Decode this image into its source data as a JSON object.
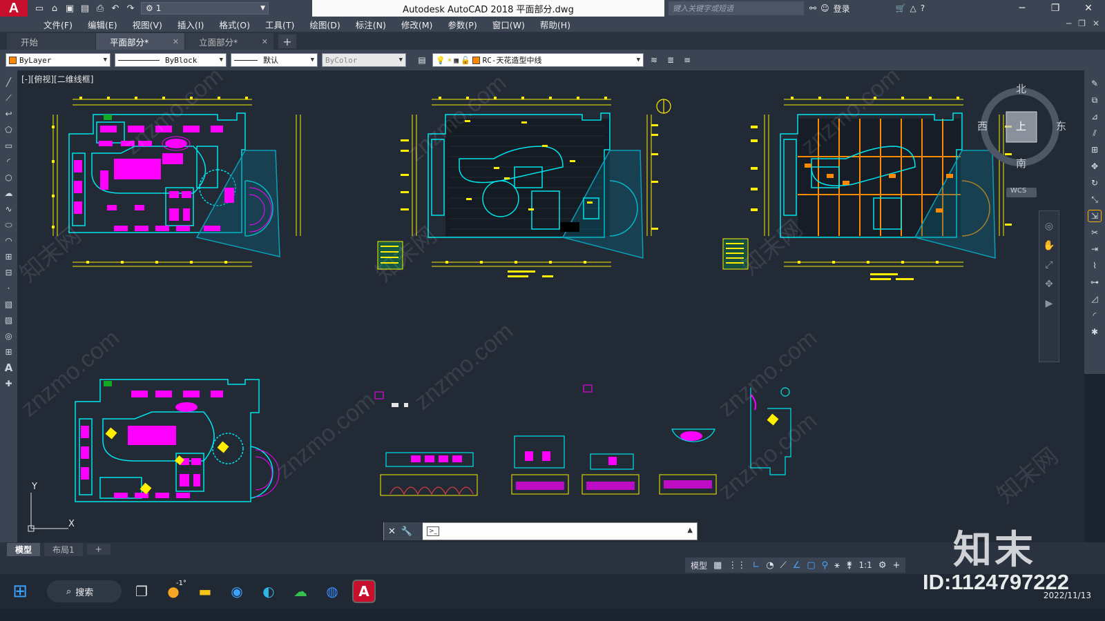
{
  "titlebar": {
    "logo": "A",
    "workspace": "1",
    "title": "Autodesk AutoCAD 2018    平面部分.dwg",
    "search_placeholder": "键入关键字或短语",
    "signin": "登录"
  },
  "menu": {
    "items": [
      "文件(F)",
      "编辑(E)",
      "视图(V)",
      "插入(I)",
      "格式(O)",
      "工具(T)",
      "绘图(D)",
      "标注(N)",
      "修改(M)",
      "参数(P)",
      "窗口(W)",
      "帮助(H)"
    ]
  },
  "tabs": {
    "items": [
      {
        "label": "开始",
        "active": false,
        "closable": false
      },
      {
        "label": "平面部分*",
        "active": true,
        "closable": true
      },
      {
        "label": "立面部分*",
        "active": false,
        "closable": true
      }
    ],
    "add": "+"
  },
  "properties": {
    "color": "ByLayer",
    "color_swatch": "#ff8800",
    "linetype": "ByBlock",
    "lineweight": "默认",
    "plotstyle": "ByColor",
    "layer": "RC-天花造型中线",
    "layer_swatch": "#ff8800"
  },
  "viewport": {
    "label": "[-][俯视][二维线框]",
    "viewcube": {
      "north": "北",
      "south": "南",
      "east": "东",
      "west": "西",
      "face": "上",
      "wcs": "WCS"
    },
    "ucs_x": "X",
    "ucs_y": "Y",
    "watermark": "znzmo.com",
    "watermark_cn": "知末网"
  },
  "commandline": {
    "value": "",
    "placeholder": ""
  },
  "layouts": {
    "items": [
      "模型",
      "布局1"
    ],
    "active": "模型",
    "add": "+"
  },
  "status": {
    "model": "模型",
    "scale": "1:1"
  },
  "taskbar": {
    "search": "搜索",
    "weather": "-1°"
  },
  "overlay": {
    "brand": "知末",
    "id": "ID:1124797222",
    "date": "2022/11/13"
  },
  "colors": {
    "cad_bg": "#222a36",
    "cyan": "#00e5ee",
    "magenta": "#ff00ff",
    "yellow": "#ffee00",
    "orange": "#ff8a00",
    "ui_dark": "#3b4453"
  }
}
